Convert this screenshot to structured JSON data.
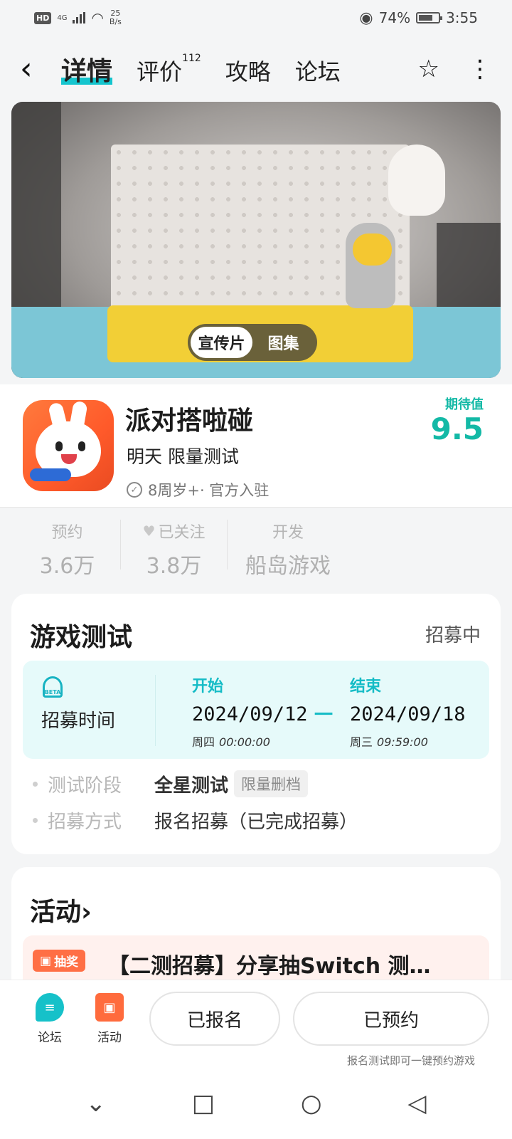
{
  "status_bar": {
    "hd": "HD",
    "network": "4G",
    "speed_top": "25",
    "speed_bottom": "B/s",
    "battery_level_percent": 74,
    "battery_text": "74%",
    "time": "3:55"
  },
  "nav": {
    "back": "‹",
    "tabs": [
      {
        "label": "详情"
      },
      {
        "label": "评价",
        "count": "112"
      },
      {
        "label": "攻略"
      },
      {
        "label": "论坛"
      }
    ],
    "star": "☆",
    "more": "⋮"
  },
  "banner": {
    "options": [
      {
        "label": "宣传片"
      },
      {
        "label": "图集"
      }
    ]
  },
  "game": {
    "name": "派对搭啦碰",
    "subtitle": "明天 限量测试",
    "meta": "8周岁+· 官方入驻",
    "expect_label": "期待值",
    "expect_value": "9.5"
  },
  "stats": [
    {
      "label": "预约",
      "value": "3.6万"
    },
    {
      "label": "已关注",
      "value": "3.8万"
    },
    {
      "label": "开发",
      "value": "船岛游戏"
    }
  ],
  "test_card": {
    "title": "游戏测试",
    "status": "招募中",
    "box_label": "招募时间",
    "beta": "BETA",
    "start": {
      "head": "开始",
      "date": "2024/09/12",
      "weekday": "周四",
      "time": "00:00:00"
    },
    "end": {
      "head": "结束",
      "date": "2024/09/18",
      "weekday": "周三",
      "time": "09:59:00"
    },
    "arrow": "一",
    "rows": [
      {
        "label": "测试阶段",
        "value": "全星测试",
        "tag": "限量删档"
      },
      {
        "label": "招募方式",
        "value": "报名招募（已完成招募）"
      }
    ]
  },
  "activity": {
    "title": "活动",
    "chevron": "›",
    "badge": "抽奖",
    "item_text": "【二测招募】分享抽Switch 测…"
  },
  "bottom_bar": {
    "forum_label": "论坛",
    "activity_label": "活动",
    "btn_signed": "已报名",
    "btn_reserved": "已预约",
    "hint": "报名测试即可一键预约游戏"
  },
  "sys_nav": {
    "down": "⌄",
    "square": "□",
    "circle": "○",
    "back": "◁"
  },
  "colors": {
    "accent": "#15c5ce",
    "expect": "#13b9a6",
    "orange": "#ff6f45"
  }
}
